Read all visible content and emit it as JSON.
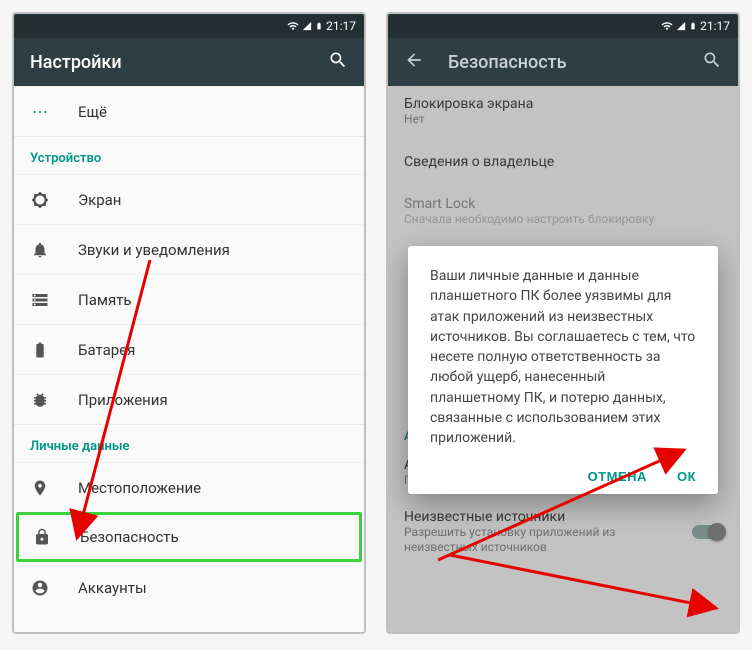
{
  "status": {
    "time": "21:17"
  },
  "left": {
    "title": "Настройки",
    "more_label": "Ещё",
    "sections": {
      "device": {
        "header": "Устройство",
        "items": {
          "display": "Экран",
          "sound": "Звуки и уведомления",
          "memory": "Память",
          "battery": "Батарея",
          "apps": "Приложения"
        }
      },
      "personal": {
        "header": "Личные данные",
        "items": {
          "location": "Местоположение",
          "security": "Безопасность",
          "accounts": "Аккаунты"
        }
      }
    }
  },
  "right": {
    "title": "Безопасность",
    "screen_lock": {
      "title": "Блокировка экрана",
      "value": "Нет"
    },
    "owner_info": "Сведения о владельце",
    "smart_lock": {
      "title": "Smart Lock",
      "sub": "Сначала необходимо настроить блокировку"
    },
    "admin_header": "Администрирование устройства",
    "admins": {
      "title": "Администраторы устройства",
      "sub": "Просмотр/отключение администраторов"
    },
    "unknown": {
      "title": "Неизвестные источники",
      "sub": "Разрешить установку приложений из неизвестных источников"
    },
    "dialog": {
      "message": "Ваши личные данные и данные планшетного ПК более уязвимы для атак приложений из неизвестных источников. Вы соглашаетесь с тем, что несете полную ответственность за любой ущерб, нанесенный планшетному ПК, и потерю данных, связанные с использованием этих приложений.",
      "cancel": "ОТМЕНА",
      "ok": "ОК"
    }
  }
}
